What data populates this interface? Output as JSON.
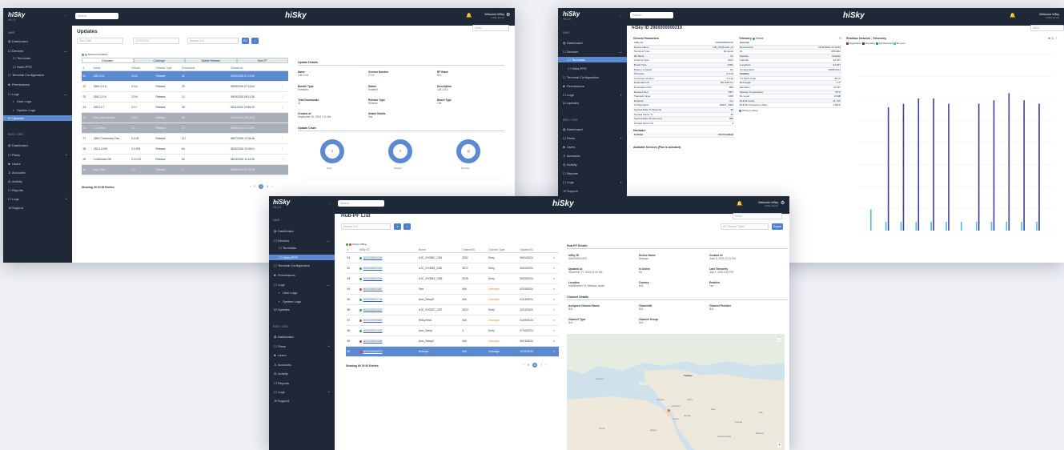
{
  "brand": {
    "logo": "hiSky",
    "version": "V5.2.0",
    "user": "Welcome hiSky",
    "role": "hiSky Admin",
    "search": "Search"
  },
  "sidebar": {
    "nms": "NMS",
    "items": [
      "Dashboard",
      "Devices",
      "Terminals",
      "Hubs-PPS",
      "Terminal Configuration",
      "Permissions",
      "Logs",
      "User Logs",
      "System Logs",
      "Updates"
    ],
    "bss": "BSS / OSS",
    "bss_items": [
      "Dashboard",
      "Plans",
      "Users",
      "Accounts",
      "Activity",
      "Reports",
      "Logs",
      "Support"
    ]
  },
  "updates": {
    "title": "Updates",
    "start": "Start Date",
    "end": "12/31/2024",
    "search": "Search Text",
    "go": "GO",
    "menu": "Menu",
    "legend": "Selected  Disabled",
    "tabs": [
      "Firmware",
      "Coverage",
      "Mobile Release",
      "Hub-PF"
    ],
    "cols": [
      "#",
      "Name",
      "Version",
      "Release Type",
      "Downloads",
      "Created At"
    ],
    "rows": [
      [
        "31",
        "138.2.0.6",
        "2.0.6",
        "Release",
        "41",
        "09/30/2024 07:11:00"
      ],
      [
        "22",
        "138G.2.0.6",
        "2.0.6",
        "Release",
        "25",
        "09/26/2024 07:10:00"
      ],
      [
        "23",
        "138G.2.0.6",
        "2.0.6",
        "Release",
        "12",
        "09/19/2024 08:11:28"
      ],
      [
        "24",
        "138.2.0.7",
        "2.0.7",
        "Release",
        "38",
        "09/11/2024 20:55:29"
      ],
      [
        "25",
        "Test_Apachelease",
        "2.0.2",
        "Release",
        "55",
        "09/10/2024 15:12:00"
      ],
      [
        "26",
        "1.1.0.Beta",
        "0.2",
        "Release",
        "15",
        "09/08/2024 14:10:05"
      ],
      [
        "27",
        "138G Conversion Fas...",
        "0.0.99",
        "Release",
        "117",
        "08/27/2024 12:34:48"
      ],
      [
        "28",
        "138.2.0.209",
        "2.0.209",
        "Release",
        "84",
        "08/20/2024 15:35:01"
      ],
      [
        "29",
        "Conversion138",
        "2.0.0.20",
        "Release",
        "63",
        "08/13/2024 11:44:25"
      ],
      [
        "30",
        "Test_Files",
        "1.2",
        "Release",
        "1",
        "08/06/2024 07:21:06"
      ]
    ],
    "showing": "Showing 30 Of 89 Entries",
    "details": {
      "title": "Update Details",
      "name_l": "Name",
      "name": "138.2.0.6",
      "ver_l": "Version Number",
      "ver": "2.0.6",
      "rf_l": "RF Band",
      "rf": "N/A",
      "bt_l": "Bundle Type",
      "bt": "Firmware",
      "st_l": "Status",
      "st": "Enabled",
      "de_l": "Description",
      "de": "138.2.0.6",
      "td_l": "Total Downloads",
      "td": "41",
      "rt_l": "Release Type",
      "rt": "Release",
      "bd_l": "Board Type",
      "bd": "138",
      "ca_l": "Created At",
      "ca": "September 30, 2024 7:11 AM",
      "am_l": "Attach Mobile",
      "am": "Yes"
    },
    "chart": {
      "title": "Update Chart",
      "labels": [
        "Daily",
        "Weekly",
        "Monthly"
      ],
      "values": [
        "0",
        "9",
        "12"
      ]
    }
  },
  "telemetry": {
    "title": "hiSky ID 2960000000219",
    "menu": "Menu",
    "gp": "General Parameters",
    "gp_rows": [
      [
        "hiSky ID",
        "2960000000219"
      ],
      [
        "Device Name",
        "198_2TQ6-215_14"
      ],
      [
        "Terminal Type",
        "Dynamic"
      ],
      [
        "RF Band",
        "Ku"
      ],
      [
        "Antenna Type",
        "Slot1"
      ],
      [
        "Board Type",
        "138G"
      ],
      [
        "Battery Installed",
        "No"
      ],
      [
        "Firmware",
        "2.0.10"
      ],
      [
        "Coverage Version",
        "2.4.10"
      ],
      [
        "Destination IP",
        "182.168.0.1"
      ],
      [
        "Destination Port",
        "550"
      ],
      [
        "Receive Port",
        "7007"
      ],
      [
        "Transport layer",
        "UDP"
      ],
      [
        "Enabled",
        "Yes"
      ],
      [
        "Configuration",
        "DEFN_2024"
      ],
      [
        "Symbol Rate Tx [ksym/s]",
        "50"
      ],
      [
        "Spread Factor Tx",
        "30"
      ],
      [
        "Symbol Rate Rx [ksym/s]",
        "480"
      ],
      [
        "Spread Factor Rx",
        "3"
      ]
    ],
    "hw": "Hardware",
    "hw_row": [
      "Cellular",
      "Not Installed"
    ],
    "avail": "Available Services (Plan is activated)",
    "tel": "Telemetry",
    "online": "Online",
    "tel_rows": [
      [
        "General",
        ""
      ],
      [
        "Received At",
        "12/31/2024 11:33:09"
      ],
      [
        "ID",
        "9751463"
      ],
      [
        "Medium",
        "Satellite"
      ],
      [
        "Latitude",
        "32.077"
      ],
      [
        "Longitude",
        "34.877"
      ],
      [
        "Configuration",
        "1238D1143"
      ],
      [
        "Satellite",
        ""
      ],
      [
        "TX Pitch angle",
        "-55.4°"
      ],
      [
        "Roll Angle",
        "1.4°"
      ],
      [
        "Elevation",
        "21.46°"
      ],
      [
        "Medium Temperature",
        "50°C"
      ],
      [
        "Rx Level",
        "0.5dB"
      ],
      [
        "RLB Rx band",
        "11.74V"
      ],
      [
        "RLB Rx Frequency offset",
        "1.5kHz"
      ]
    ],
    "lookup": "Whois Lookup",
    "rt": "Realtime Network - Telemetry",
    "rt_legend": [
      "Registration",
      "Keepalive",
      "Ack Received",
      "Rx Level"
    ],
    "bars": [
      0,
      0,
      0,
      0,
      0,
      0,
      0,
      0,
      0,
      0,
      0,
      0,
      0,
      0,
      0,
      0,
      0,
      0,
      0,
      0,
      0,
      0,
      0,
      0,
      0,
      0,
      0,
      0,
      0,
      0,
      0,
      0,
      0,
      0,
      0,
      0,
      0,
      0,
      0,
      0,
      0,
      0,
      0,
      0,
      0,
      0,
      0,
      0,
      0,
      0,
      0,
      0,
      0,
      0,
      0,
      0,
      0,
      0,
      0,
      0,
      0,
      0,
      0,
      0,
      0,
      0,
      0,
      0,
      0,
      0
    ],
    "bar_pairs": [
      [
        0.12,
        0
      ],
      [
        0.05,
        0.7
      ],
      [
        0.05,
        0.72
      ],
      [
        0.05,
        0.75
      ],
      [
        0.05,
        0.75
      ],
      [
        0.05,
        0.72
      ],
      [
        0.05,
        0
      ],
      [
        0.05,
        0.72
      ],
      [
        0.05,
        0.74
      ],
      [
        0.05,
        0.78
      ],
      [
        0.05,
        0.74
      ],
      [
        0.05,
        0.72
      ]
    ]
  },
  "hubs": {
    "title": "Hub-PF List",
    "search": "Search Text",
    "menu": "Menu",
    "types": "All Channel Types",
    "export": "Export",
    "legend": "Online  Offline",
    "cols": [
      "#",
      "hiSky ID",
      "Name",
      "ChannelID",
      "Channel Type",
      "Updated At",
      ""
    ],
    "rows": [
      [
        "51",
        "on",
        "5000000002052",
        "UJC_CH3052_1351",
        "3052",
        "Entry",
        "06/24/2024",
        ">"
      ],
      [
        "52",
        "on",
        "5000000002053",
        "UJC_CH3053_1352",
        "3072",
        "Entry",
        "06/24/2024",
        ">"
      ],
      [
        "53",
        "on",
        "5000000002054",
        "UJC_CH3054_1353",
        "3026",
        "Entry",
        "06/24/2024",
        ">"
      ],
      [
        "54",
        "off",
        "5000000002067",
        "Test",
        "N/A",
        "Unassign",
        "02/29/2024",
        ">"
      ],
      [
        "55",
        "on",
        "5000000001746",
        "Alon_Setup5",
        "N/A",
        "Unassign",
        "01/15/2024",
        ">"
      ],
      [
        "56",
        "on",
        "5000000003022",
        "UJC_CH3022_1337",
        "3022",
        "Entry",
        "12/11/2024",
        ">"
      ],
      [
        "57",
        "off",
        "5000000009880",
        "HiSkyTest1",
        "N/A",
        "Unassign",
        "01/09/2024",
        ">"
      ],
      [
        "58",
        "on",
        "5000000002083",
        "Alon_Setup",
        "4",
        "Entry",
        "07/04/2024",
        ">"
      ],
      [
        "59",
        "off",
        "5000000002084",
        "Alon_Setup2",
        "N/A",
        "Unassign",
        "06/15/2024",
        ">"
      ],
      [
        "60",
        "off",
        "5000000004972",
        "Netanya",
        "N/A",
        "Unassign",
        "12/31/2023",
        ">"
      ]
    ],
    "showing": "Showing 60 Of 62 Entries",
    "details": {
      "title": "Hub-PF Details",
      "id_l": "hiSky ID",
      "id": "5000000004972",
      "dn_l": "Device Name",
      "dn": "Netanya",
      "ca_l": "Created At",
      "ca": "June 8, 2023 12:21 PM",
      "ua_l": "Updated At",
      "ua": "December 27, 2023 10:40 AM",
      "io_l": "Is Online",
      "io": "No",
      "lt_l": "Last Telemetry",
      "lt": "July 2, 2023 4:40 PM",
      "lo_l": "Location",
      "lo": "HaMelekhim St, Netanya, Israel",
      "co_l": "Country",
      "co": "N/A",
      "en_l": "Enabled",
      "en": "Yes",
      "cd": "Channel Details",
      "acn_l": "Assigned Channel Name",
      "acn": "N/A",
      "cid_l": "ChannelID",
      "cid": "N/A",
      "cp_l": "Channel Provider",
      "cp": "N/A",
      "ct_l": "Channel Type",
      "ct": "N/A",
      "cg_l": "Channel Group",
      "cg": "N/A"
    },
    "map": [
      "Türkiye",
      "Greece",
      "Syria",
      "Iraq",
      "Iran",
      "Cyprus",
      "Lebanon",
      "Israel",
      "Jordan",
      "Kuwait",
      "Egypt",
      "Libya",
      "Saudi Arabia",
      "Bahrain"
    ]
  },
  "colors": {
    "sidebar": "#1e2837",
    "accent": "#5b8ad0",
    "online": "#22a652",
    "offline": "#e04040"
  }
}
